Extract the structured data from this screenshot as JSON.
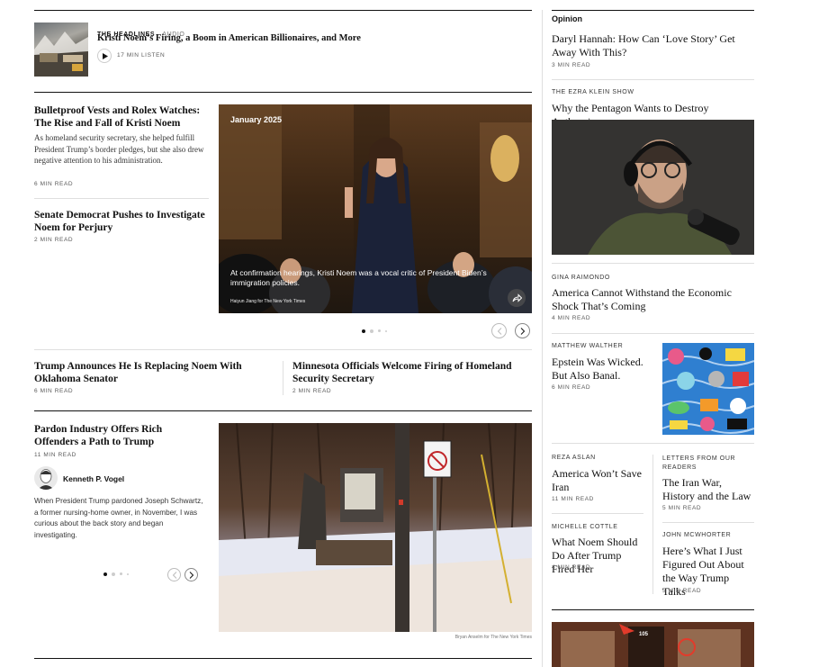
{
  "headlines": {
    "kicker": "The Headlines",
    "tag": "Audio",
    "title": "Kristi Noem’s Firing, a Boom in American Billionaires, and More",
    "listen": "17 MIN LISTEN"
  },
  "story1": {
    "title": "Bulletproof Vests and Rolex Watches: The Rise and Fall of Kristi Noem",
    "summary": "As homeland security secretary, she helped fulfill President Trump’s border pledges, but she also drew negative attention to his administration.",
    "meta": "6 MIN READ"
  },
  "story2": {
    "title": "Senate Democrat Pushes to Investigate Noem for Perjury",
    "meta": "2 MIN READ"
  },
  "hero": {
    "badge": "January 2025",
    "caption": "At confirmation hearings, Kristi Noem was a vocal critic of President Biden’s immigration policies.",
    "credit": "Haiyun Jiang for The New York Times"
  },
  "story3": {
    "title": "Trump Announces He Is Replacing Noem With Oklahoma Senator",
    "meta": "6 MIN READ"
  },
  "story4": {
    "title": "Minnesota Officials Welcome Firing of Homeland Security Secretary",
    "meta": "2 MIN READ"
  },
  "story5": {
    "title": "Pardon Industry Offers Rich Offenders a Path to Trump",
    "meta": "11 MIN READ",
    "author": "Kenneth P. Vogel",
    "summary": "When President Trump pardoned Joseph Schwartz, a former nursing-home owner, in November, I was curious about the back story and began investigating.",
    "photo_credit": "Bryan Anselm for The New York Times"
  },
  "opinion": {
    "section": "Opinion",
    "items": [
      {
        "kicker": "",
        "title": "Daryl Hannah: How Can ‘Love Story’ Get Away With This?",
        "meta": "3 MIN READ"
      },
      {
        "kicker": "The Ezra Klein Show",
        "title": "Why the Pentagon Wants to Destroy Anthropic",
        "meta": ""
      },
      {
        "kicker": "Gina Raimondo",
        "title": "America Cannot Withstand the Economic Shock That’s Coming",
        "meta": "4 MIN READ"
      },
      {
        "kicker": "Matthew Walther",
        "title": "Epstein Was Wicked. But Also Banal.",
        "meta": "6 MIN READ"
      },
      {
        "kicker": "Reza Aslan",
        "title": "America Won’t Save Iran",
        "meta": "11 MIN READ"
      },
      {
        "kicker": "Letters From Our Readers",
        "title": "The Iran War, History and the Law",
        "meta": "5 MIN READ"
      },
      {
        "kicker": "Michelle Cottle",
        "title": "What Noem Should Do After Trump Fired Her",
        "meta": "4 MIN READ"
      },
      {
        "kicker": "John McWhorter",
        "title": "Here’s What I Just Figured Out About the Way Trump Talks",
        "meta": "5 MIN READ"
      }
    ],
    "store_sign": "105"
  },
  "colors": {
    "accent": "#121212",
    "rule": "#dfdfdf"
  },
  "icons": [
    "play-icon",
    "chevron-left-icon",
    "chevron-right-icon",
    "share-icon"
  ]
}
